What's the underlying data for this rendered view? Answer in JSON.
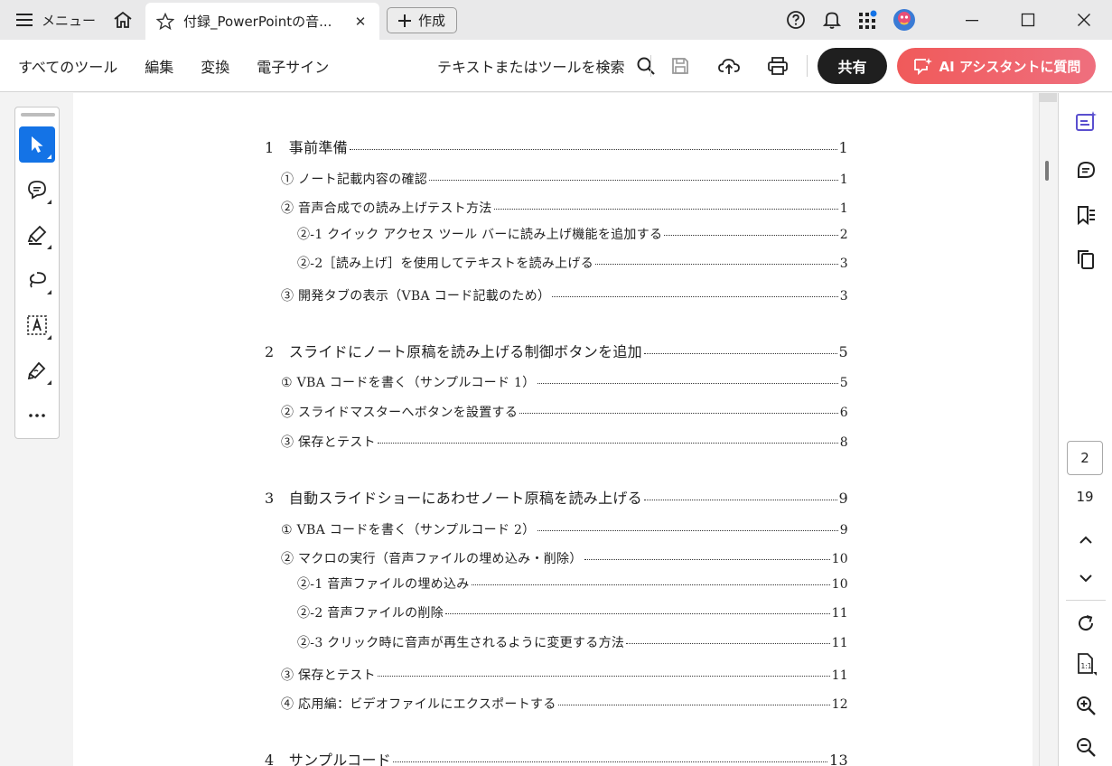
{
  "titlebar": {
    "menu_label": "メニュー",
    "tab_title": "付録_PowerPointの音...",
    "tab_close": "✕",
    "create_label": "作成",
    "icons": [
      "hamburger-icon",
      "home-icon",
      "star-icon",
      "help-icon",
      "bell-icon",
      "apps-grid-icon",
      "avatar",
      "minimize-icon",
      "maximize-icon",
      "close-icon"
    ]
  },
  "toolbar": {
    "menus": [
      "すべてのツール",
      "編集",
      "変換",
      "電子サイン"
    ],
    "search_label": "テキストまたはツールを検索",
    "share_label": "共有",
    "ai_label": "AI アシスタントに質問",
    "colors": {
      "share_bg": "#1f1f1f",
      "ai_bg": "#f05a5a",
      "active_tool": "#1473e6"
    }
  },
  "toc": [
    {
      "level": 1,
      "text": "1　事前準備",
      "page": "1"
    },
    {
      "level": 2,
      "text": "① ノート記載内容の確認",
      "page": "1"
    },
    {
      "level": 2,
      "text": "② 音声合成での読み上げテスト方法",
      "page": "1"
    },
    {
      "level": 3,
      "text": "②-1 クイック アクセス ツール バーに読み上げ機能を追加する",
      "page": "2"
    },
    {
      "level": 3,
      "text": "②-2［読み上げ］を使用してテキストを読み上げる",
      "page": "3"
    },
    {
      "level": 2,
      "text": "③ 開発タブの表示（VBA コード記載のため）",
      "page": "3"
    },
    {
      "level": 1,
      "text": "2　スライドにノート原稿を読み上げる制御ボタンを追加",
      "page": "5"
    },
    {
      "level": 2,
      "text": "① VBA コードを書く（サンプルコード 1）",
      "page": "5"
    },
    {
      "level": 2,
      "text": "② スライドマスターへボタンを設置する",
      "page": "6"
    },
    {
      "level": 2,
      "text": "③ 保存とテスト",
      "page": "8"
    },
    {
      "level": 1,
      "text": "3　自動スライドショーにあわせノート原稿を読み上げる",
      "page": "9"
    },
    {
      "level": 2,
      "text": "① VBA コードを書く（サンプルコード 2）",
      "page": "9"
    },
    {
      "level": 2,
      "text": "② マクロの実行（音声ファイルの埋め込み・削除）",
      "page": "10"
    },
    {
      "level": 3,
      "text": "②-1 音声ファイルの埋め込み",
      "page": "10"
    },
    {
      "level": 3,
      "text": "②-2 音声ファイルの削除",
      "page": "11"
    },
    {
      "level": 3,
      "text": "②-3 クリック時に音声が再生されるように変更する方法",
      "page": "11"
    },
    {
      "level": 2,
      "text": "③ 保存とテスト",
      "page": "11"
    },
    {
      "level": 2,
      "text": "④ 応用編：ビデオファイルにエクスポートする",
      "page": "12"
    },
    {
      "level": 1,
      "text": "4　サンプルコード",
      "page": "13"
    }
  ],
  "pager": {
    "current": "2",
    "total": "19"
  }
}
